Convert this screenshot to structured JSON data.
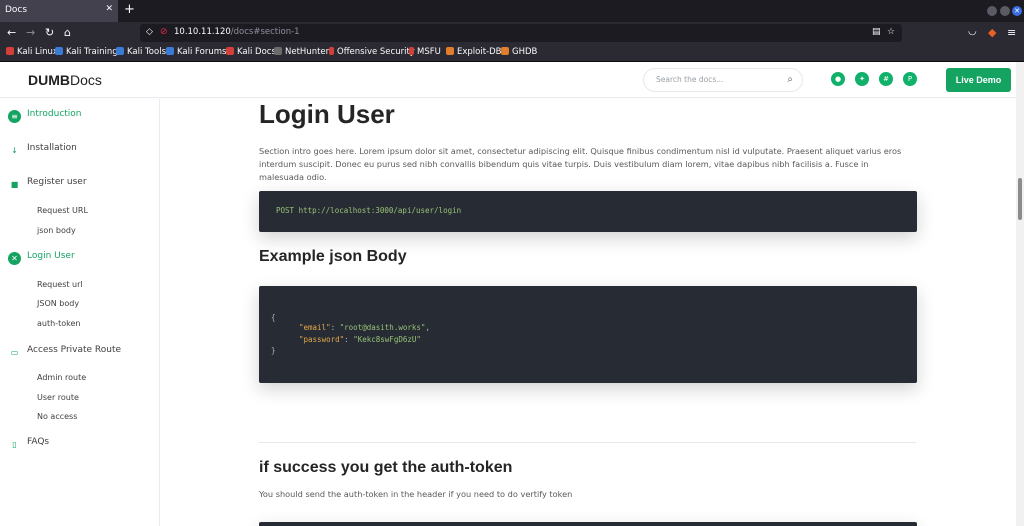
{
  "browser": {
    "tab_title": "Docs",
    "url_host": "10.10.11.120",
    "url_path": "/docs#section-1",
    "bookmarks": [
      "Kali Linux",
      "Kali Training",
      "Kali Tools",
      "Kali Forums",
      "Kali Docs",
      "NetHunter",
      "Offensive Security",
      "MSFU",
      "Exploit-DB",
      "GHDB"
    ]
  },
  "header": {
    "logo_bold": "DUMB",
    "logo_rest": "Docs",
    "search_placeholder": "Search the docs...",
    "live_demo": "Live Demo"
  },
  "sidebar": {
    "introduction": "Introduction",
    "installation": "Installation",
    "register_user": "Register user",
    "register_sub": [
      "Request URL",
      "json body"
    ],
    "login_user": "Login User",
    "login_sub": [
      "Request url",
      "JSON body",
      "auth-token"
    ],
    "private_route": "Access Private Route",
    "private_sub": [
      "Admin route",
      "User route",
      "No access"
    ],
    "faqs": "FAQs"
  },
  "main": {
    "title": "Login User",
    "intro": "Section intro goes here. Lorem ipsum dolor sit amet, consectetur adipiscing elit. Quisque finibus condimentum nisl id vulputate. Praesent aliquet varius eros interdum suscipit. Donec eu purus sed nibh convallis bibendum quis vitae turpis. Duis vestibulum diam lorem, vitae dapibus nibh facilisis a. Fusce in malesuada odio.",
    "request_line": "POST http://localhost:3000/api/user/login",
    "json_heading": "Example json Body",
    "json_open": "{",
    "json_email_key": "\"email\"",
    "json_email_val": "\"root@dasith.works\"",
    "json_password_key": "\"password\"",
    "json_password_val": "\"Kekc8swFgD6zU\"",
    "json_close": "}",
    "success_heading": "if success you get the auth-token",
    "success_note": "You should send the auth-token in the header if you need to do vertify token"
  },
  "colors": {
    "accent": "#15a362",
    "code_bg": "#272b33"
  }
}
